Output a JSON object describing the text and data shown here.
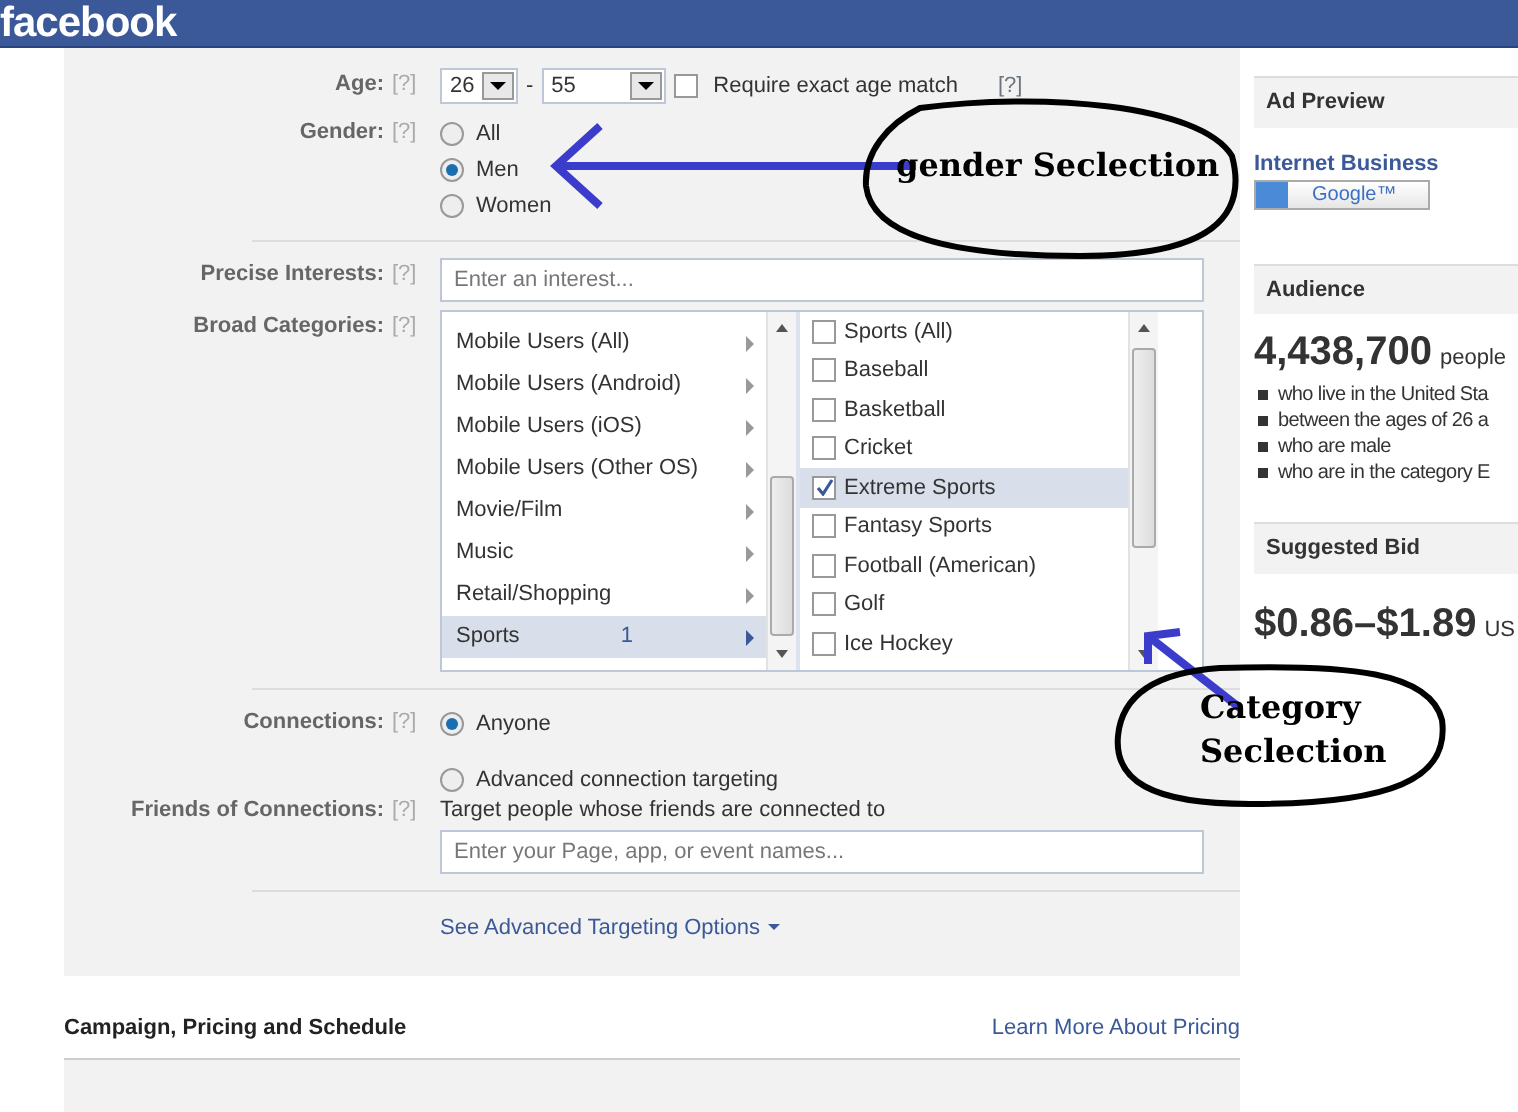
{
  "header": {
    "logo": "facebook"
  },
  "targeting": {
    "age": {
      "label": "Age:",
      "help": "[?]",
      "min": "26",
      "separator": "-",
      "max": "55",
      "exact": {
        "label": "Require exact age match",
        "checked": false,
        "help": "[?]"
      }
    },
    "gender": {
      "label": "Gender:",
      "help": "[?]",
      "options": [
        {
          "label": "All",
          "selected": false
        },
        {
          "label": "Men",
          "selected": true
        },
        {
          "label": "Women",
          "selected": false
        }
      ]
    },
    "precise": {
      "label": "Precise Interests:",
      "help": "[?]",
      "placeholder": "Enter an interest..."
    },
    "broad": {
      "label": "Broad Categories:",
      "help": "[?]",
      "categories": [
        {
          "label": "Mobile Users (All)",
          "selected": false
        },
        {
          "label": "Mobile Users (Android)",
          "selected": false
        },
        {
          "label": "Mobile Users (iOS)",
          "selected": false
        },
        {
          "label": "Mobile Users (Other OS)",
          "selected": false
        },
        {
          "label": "Movie/Film",
          "selected": false
        },
        {
          "label": "Music",
          "selected": false
        },
        {
          "label": "Retail/Shopping",
          "selected": false
        },
        {
          "label": "Sports",
          "count": "1",
          "selected": true
        }
      ],
      "subcategories": [
        {
          "label": "Sports (All)",
          "checked": false
        },
        {
          "label": "Baseball",
          "checked": false
        },
        {
          "label": "Basketball",
          "checked": false
        },
        {
          "label": "Cricket",
          "checked": false
        },
        {
          "label": "Extreme Sports",
          "checked": true
        },
        {
          "label": "Fantasy Sports",
          "checked": false
        },
        {
          "label": "Football (American)",
          "checked": false
        },
        {
          "label": "Golf",
          "checked": false
        },
        {
          "label": "Ice Hockey",
          "checked": false
        }
      ]
    },
    "connections": {
      "label": "Connections:",
      "help": "[?]",
      "options": [
        {
          "label": "Anyone",
          "selected": true
        },
        {
          "label": "Advanced connection targeting",
          "selected": false
        }
      ]
    },
    "friends": {
      "label": "Friends of Connections:",
      "help": "[?]",
      "hint": "Target people whose friends are connected to",
      "placeholder": "Enter your Page, app, or event names..."
    },
    "advanced_link": "See Advanced Targeting Options"
  },
  "campaign": {
    "title": "Campaign, Pricing and Schedule",
    "link": "Learn More About Pricing"
  },
  "sidebar": {
    "ad_preview": {
      "title": "Ad Preview",
      "ad_title": "Internet Business",
      "google_button": "Google™"
    },
    "audience": {
      "title": "Audience",
      "count": "4,438,700",
      "unit": "people",
      "criteria": [
        "who live in the United Sta",
        "between the ages of 26 a",
        "who are male",
        "who are in the category E"
      ]
    },
    "bid": {
      "title": "Suggested Bid",
      "range": "$0.86–$1.89",
      "currency": "US"
    }
  },
  "annotations": [
    {
      "text": "gender Seclection"
    },
    {
      "text": "Category Seclection"
    }
  ]
}
